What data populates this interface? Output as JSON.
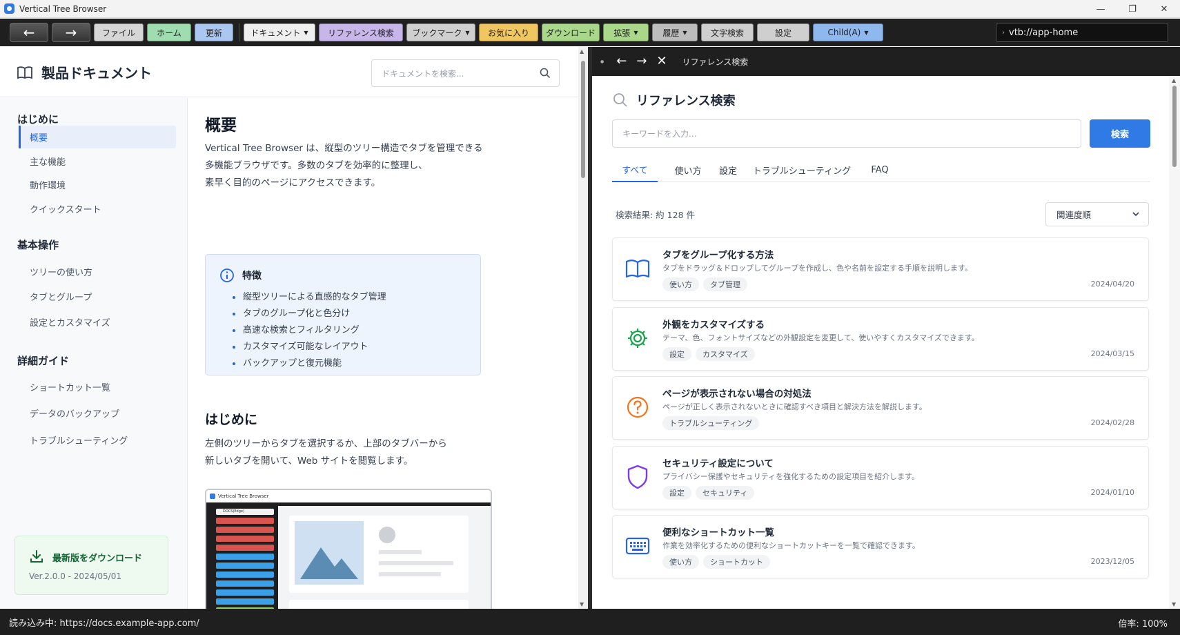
{
  "window": {
    "title": "Vertical Tree Browser",
    "ctrl_min": "—",
    "ctrl_max": "❐",
    "ctrl_close": "✕"
  },
  "toolbar": {
    "back": "←",
    "forward": "→",
    "buttons": [
      {
        "label": "ファイル",
        "color": "#d6d6d6",
        "caret": ""
      },
      {
        "label": "ホーム",
        "color": "#9fdcb0",
        "caret": ""
      },
      {
        "label": "更新",
        "color": "#a9c7f0",
        "caret": ""
      },
      {
        "label": "ドキュメント",
        "color": "#efefef",
        "caret": "▼"
      },
      {
        "label": "リファレンス検索",
        "color": "#c8b6ea",
        "caret": ""
      },
      {
        "label": "ブックマーク",
        "color": "#cfcfcf",
        "caret": "▼"
      },
      {
        "label": "お気に入り",
        "color": "#f0c660",
        "caret": ""
      },
      {
        "label": "ダウンロード",
        "color": "#a9d88a",
        "caret": ""
      },
      {
        "label": "拡張",
        "color": "#a9d88a",
        "caret": "▼"
      },
      {
        "label": "履歴",
        "color": "#bdbdbd",
        "caret": "▼"
      },
      {
        "label": "文字検索",
        "color": "#cfcfcf",
        "caret": ""
      },
      {
        "label": "設定",
        "color": "#cfcfcf",
        "caret": ""
      },
      {
        "label": "Child(A)",
        "color": "#8fb8ee",
        "caret": "▼"
      }
    ],
    "url": "vtb://app-home",
    "url_chevron": "›"
  },
  "left": {
    "title": "製品ドキュメント",
    "search_placeholder": "ドキュメントを検索...",
    "sidebar": {
      "groups": [
        {
          "label": "はじめに",
          "items": [
            "概要",
            "主な機能",
            "動作環境",
            "クイックスタート"
          ]
        },
        {
          "label": "基本操作",
          "items": [
            "ツリーの使い方",
            "タブとグループ",
            "設定とカスタマイズ"
          ]
        },
        {
          "label": "詳細ガイド",
          "items": [
            "ショートカット一覧",
            "データのバックアップ",
            "トラブルシューティング"
          ]
        }
      ],
      "active": "概要",
      "download_title": "最新版をダウンロード",
      "download_version": "Ver.2.0.0 - 2024/05/01"
    },
    "content": {
      "heading": "概要",
      "intro": [
        "Vertical Tree Browser は、縦型のツリー構造でタブを管理できる",
        "多機能ブラウザです。多数のタブを効率的に整理し、",
        "素早く目的のページにアクセスできます。"
      ],
      "feature_title": "特徴",
      "features": [
        "縦型ツリーによる直感的なタブ管理",
        "タブのグループ化と色分け",
        "高速な検索とフィルタリング",
        "カスタマイズ可能なレイアウト",
        "バックアップと復元機能"
      ],
      "heading2": "はじめに",
      "intro2": [
        "左側のツリーからタブを選択するか、上部のタブバーから",
        "新しいタブを開いて、Web サイトを閲覧します。"
      ],
      "screenshot_title": "Vertical Tree Browser",
      "screenshot_tab": "DOCS(Edge)"
    }
  },
  "right": {
    "tab_title": "リファレンス検索",
    "heading": "リファレンス検索",
    "keyword_placeholder": "キーワードを入力...",
    "search_button": "検索",
    "tabs": [
      "すべて",
      "使い方",
      "設定",
      "トラブルシューティング",
      "FAQ"
    ],
    "active_tab": "すべて",
    "result_count": "検索結果: 約 128 件",
    "sort": "関連度順",
    "results": [
      {
        "title": "タブをグループ化する方法",
        "desc": "タブをドラッグ＆ドロップしてグループを作成し、色や名前を設定する手順を説明します。",
        "tags": [
          "使い方",
          "タブ管理"
        ],
        "date": "2024/04/20",
        "icon": "book-icon",
        "color": "#2563eb"
      },
      {
        "title": "外観をカスタマイズする",
        "desc": "テーマ、色、フォントサイズなどの外観設定を変更して、使いやすくカスタマイズできます。",
        "tags": [
          "設定",
          "カスタマイズ"
        ],
        "date": "2024/03/15",
        "icon": "gear-icon",
        "color": "#16a34a"
      },
      {
        "title": "ページが表示されない場合の対処法",
        "desc": "ページが正しく表示されないときに確認すべき項目と解決方法を解説します。",
        "tags": [
          "トラブルシューティング"
        ],
        "date": "2024/02/28",
        "icon": "question-icon",
        "color": "#f97316"
      },
      {
        "title": "セキュリティ設定について",
        "desc": "プライバシー保護やセキュリティを強化するための設定項目を紹介します。",
        "tags": [
          "設定",
          "セキュリティ"
        ],
        "date": "2024/01/10",
        "icon": "shield-icon",
        "color": "#7c3aed"
      },
      {
        "title": "便利なショートカット一覧",
        "desc": "作業を効率化するための便利なショートカットキーを一覧で確認できます。",
        "tags": [
          "使い方",
          "ショートカット"
        ],
        "date": "2023/12/05",
        "icon": "keyboard-icon",
        "color": "#2563eb"
      }
    ]
  },
  "status": {
    "loading": "読み込み中: https://docs.example-app.com/",
    "zoom": "倍率: 100%"
  }
}
